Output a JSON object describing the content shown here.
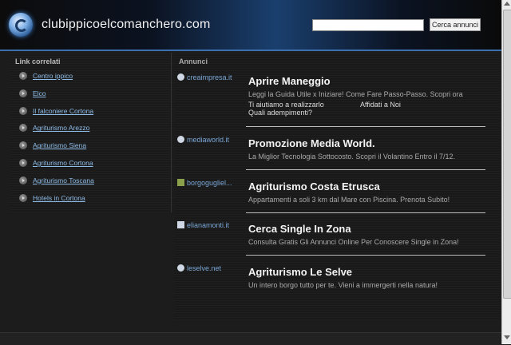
{
  "header": {
    "site_title": "clubippicoelcomanchero.com",
    "search_placeholder": "",
    "search_button": "Cerca annunci"
  },
  "sidebar": {
    "title": "Link correlati",
    "links": [
      "Centro ippico",
      "Elco",
      "Il falconiere Cortona",
      "Agriturismo Arezzo",
      "Agriturismo Siena",
      "Agriturismo Cortona",
      "Agriturismo Toscana",
      "Hotels in Cortona"
    ]
  },
  "main": {
    "title": "Annunci",
    "ads": [
      {
        "domain": "creaimpresa.it",
        "heading": "Aprire Maneggio",
        "desc": "Leggi la Guida Utile x Iniziare! Come Fare Passo-Passo. Scopri ora",
        "sub1": "Ti aiutiamo a realizzarlo",
        "sub2": "Affidati a Noi",
        "sub3": "Quali adempimenti?"
      },
      {
        "domain": "mediaworld.it",
        "heading": "Promozione Media World.",
        "desc": "La Miglior Tecnologia Sottocosto. Scopri il Volantino Entro il 7/12."
      },
      {
        "domain": "borgogugliel...",
        "heading": "Agriturismo Costa Etrusca",
        "desc": "Appartamenti a soli 3 km dal Mare con Piscina. Prenota Subito!"
      },
      {
        "domain": "elianamonti.it",
        "heading": "Cerca Single In Zona",
        "desc": "Consulta Gratis Gli Annunci Online Per Conoscere Single in Zona!"
      },
      {
        "domain": "leselve.net",
        "heading": "Agriturismo Le Selve",
        "desc": "Un intero borgo tutto per te. Vieni a immergerti nella natura!"
      }
    ]
  }
}
